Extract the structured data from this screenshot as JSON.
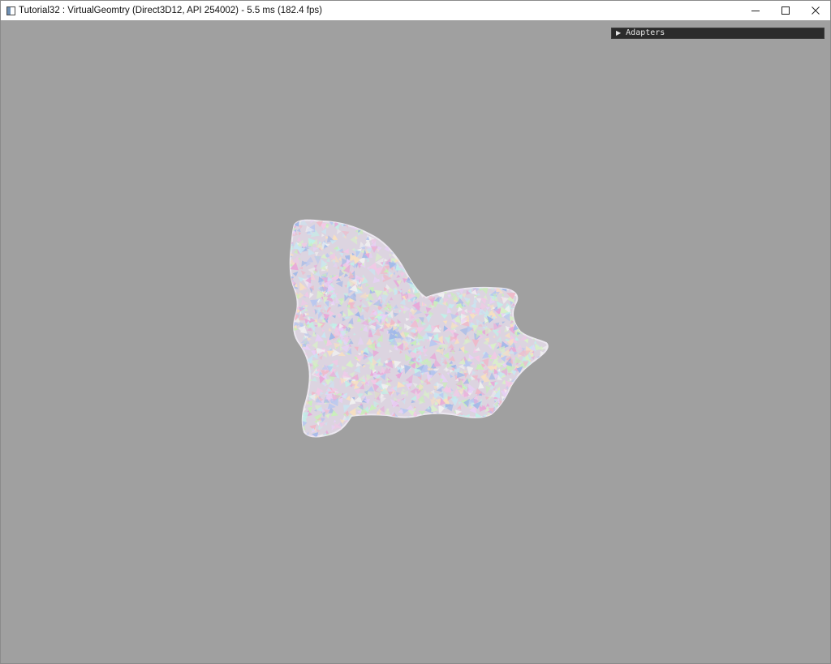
{
  "window": {
    "title": "Tutorial32 : VirtualGeomtry (Direct3D12, API 254002) - 5.5 ms (182.4 fps)",
    "app_icon": "app-window-icon",
    "controls": {
      "minimize_icon": "minimize-icon",
      "maximize_icon": "maximize-icon",
      "close_icon": "close-icon"
    }
  },
  "viewport": {
    "background_color": "#a0a0a0"
  },
  "adapters_panel": {
    "arrow_icon": "triangle-right-icon",
    "label": "Adapters",
    "expanded": false
  },
  "mesh": {
    "description_icon": "virtual-geometry-mesh",
    "palette": [
      "#f2c8e6",
      "#c8e6f2",
      "#d8f0c8",
      "#e8d0f8",
      "#f8e0c0",
      "#c0f0e8",
      "#f0f0f0",
      "#b8c8f0",
      "#f0b8c8",
      "#c8f0b8",
      "#9fb8e8",
      "#e8a8d8"
    ]
  }
}
